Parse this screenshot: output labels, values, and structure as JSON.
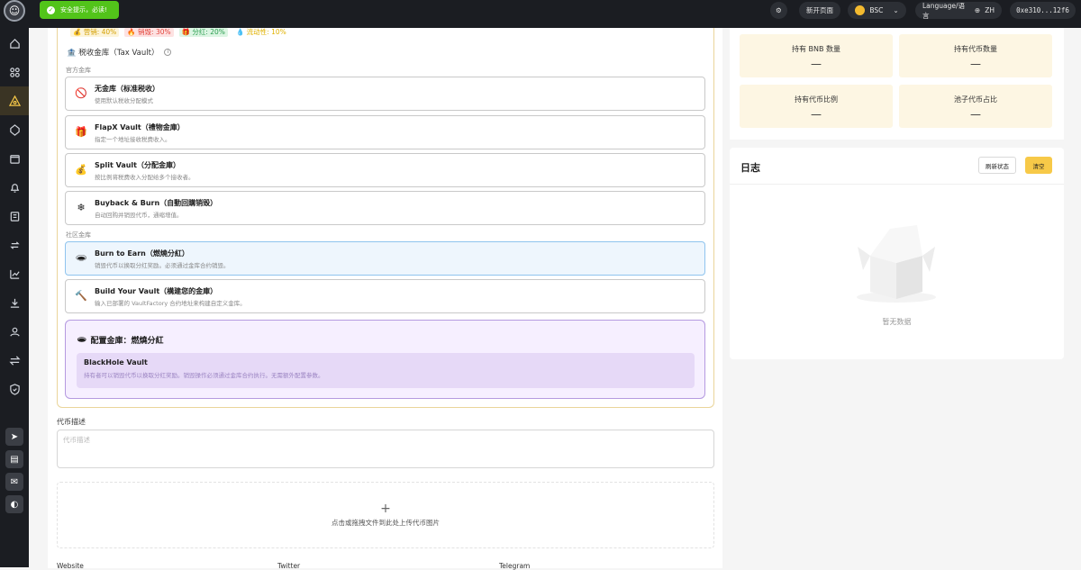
{
  "toast": {
    "text": "安全提示，必读!"
  },
  "topbar": {
    "new_page": "新开页面",
    "network": "BSC",
    "language": "Language/语言",
    "lang_code": "ZH",
    "wallet": "0xe310...12f6"
  },
  "tags": [
    {
      "label": "💰 营销: 40%",
      "color": "#d4a106",
      "bg": "#fdf4d9"
    },
    {
      "label": "🔥 销毁: 30%",
      "color": "#e2453c",
      "bg": "#fde2e2"
    },
    {
      "label": "🎁 分红: 20%",
      "color": "#2a9d4f",
      "bg": "#dcf5e3"
    },
    {
      "label": "💧 流动性: 10%",
      "color": "#e0b100",
      "bg": "#ffffff"
    }
  ],
  "tax_vault": {
    "title": "🏦 税收金库（Tax Vault）",
    "official_label": "官方金库",
    "community_label": "社区金库",
    "official": [
      {
        "icon": "🚫",
        "title": "无金库（标准税收）",
        "desc": "使用默认税收分配模式"
      },
      {
        "icon": "🎁",
        "title": "FlapX Vault（禮物金庫）",
        "desc": "指定一个地址接收税费收入。"
      },
      {
        "icon": "💰",
        "title": "Split Vault（分配金庫）",
        "desc": "按比例将税费收入分配给多个接收者。"
      },
      {
        "icon": "❄",
        "title": "Buyback & Burn（自動回購销毁）",
        "desc": "自动回购并销毁代币，通缩增值。"
      }
    ],
    "community": [
      {
        "icon": "🕳",
        "title": "Burn to Earn（燃燒分紅）",
        "desc": "销毁代币以换取分红奖励。必须通过金库合约销毁。"
      },
      {
        "icon": "🔨",
        "title": "Build Your Vault（構建您的金庫）",
        "desc": "输入已部署的 VaultFactory 合约地址来构建自定义金库。"
      }
    ],
    "config": {
      "icon": "🕳",
      "title": "配置金庫：燃燒分紅",
      "vault_name": "BlackHole Vault",
      "vault_desc": "持有者可以销毁代币以换取分红奖励。销毁操作必须通过金库合约执行。无需额外配置参数。"
    }
  },
  "description": {
    "label": "代币描述",
    "placeholder": "代币描述"
  },
  "upload": {
    "text": "点击或拖拽文件到此处上传代币图片"
  },
  "links": {
    "website": "Website",
    "twitter": "Twitter",
    "telegram": "Telegram"
  },
  "stats": {
    "bnb_label": "持有 BNB 数量",
    "bnb_value": "—",
    "token_label": "持有代币数量",
    "token_value": "—",
    "ratio_label": "持有代币比例",
    "ratio_value": "—",
    "pool_label": "池子代币占比",
    "pool_value": "—"
  },
  "log": {
    "title": "日志",
    "refresh": "刷新状态",
    "clear": "清空",
    "empty": "暂无数据"
  },
  "accent_color": "#f7c948"
}
